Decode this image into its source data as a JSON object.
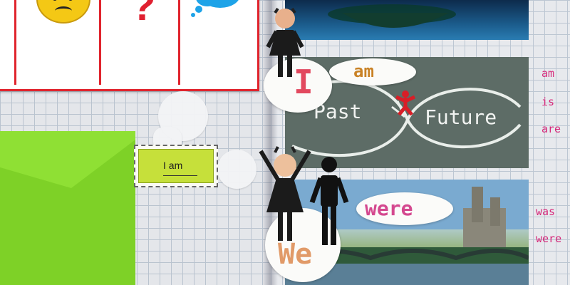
{
  "label_card": {
    "text": "I am"
  },
  "notebook_words": {
    "am": "am",
    "is": "is",
    "are": "are",
    "was": "was",
    "were": "were"
  },
  "oval_words": {
    "am": "am",
    "i": "I",
    "were": "were",
    "we": "We"
  },
  "timeline": {
    "past": "Past",
    "future": "Future"
  },
  "colors": {
    "chart_border": "#e0242d",
    "envelope": "#7ed127",
    "label_green": "#c6e03a",
    "verb_pink": "#d6287a"
  }
}
